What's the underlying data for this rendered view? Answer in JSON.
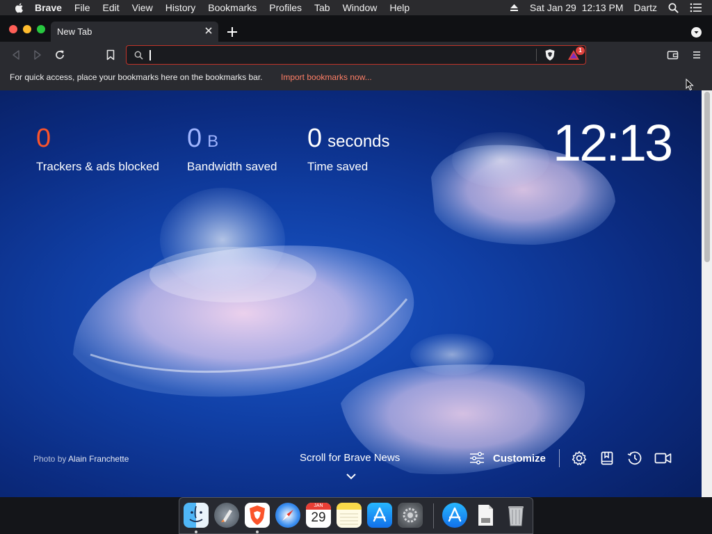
{
  "menubar": {
    "app": "Brave",
    "items": [
      "File",
      "Edit",
      "View",
      "History",
      "Bookmarks",
      "Profiles",
      "Tab",
      "Window",
      "Help"
    ],
    "clock": "Sat Jan 29  12:13 PM",
    "user": "Dartz"
  },
  "tab": {
    "title": "New Tab"
  },
  "urlbar": {
    "value": "",
    "placeholder": "",
    "rewards_badge": "1"
  },
  "bookmarks_bar": {
    "text": "For quick access, place your bookmarks here on the bookmarks bar.",
    "link": "Import bookmarks now..."
  },
  "stats": {
    "trackers": {
      "value": "0",
      "label": "Trackers & ads blocked"
    },
    "bandwidth": {
      "value": "0",
      "unit": "B",
      "label": "Bandwidth saved"
    },
    "time": {
      "value": "0",
      "unit": "seconds",
      "label": "Time saved"
    }
  },
  "clock": "12:13",
  "photo_credit": {
    "prefix": "Photo by",
    "author": "Alain Franchette"
  },
  "news": "Scroll for Brave News",
  "customize": "Customize",
  "dock": {
    "items": [
      "finder-icon",
      "launchpad-icon",
      "brave-icon",
      "safari-icon",
      "calendar-icon",
      "notes-icon",
      "app-store-icon",
      "system-preferences-icon",
      "app-store-folder-icon",
      "document-icon",
      "trash-icon"
    ],
    "calendar": {
      "month": "JAN",
      "day": "29"
    }
  },
  "colors": {
    "accent": "#fb542b",
    "link": "#ff7f66",
    "stat_blue": "#a0b5ff"
  }
}
